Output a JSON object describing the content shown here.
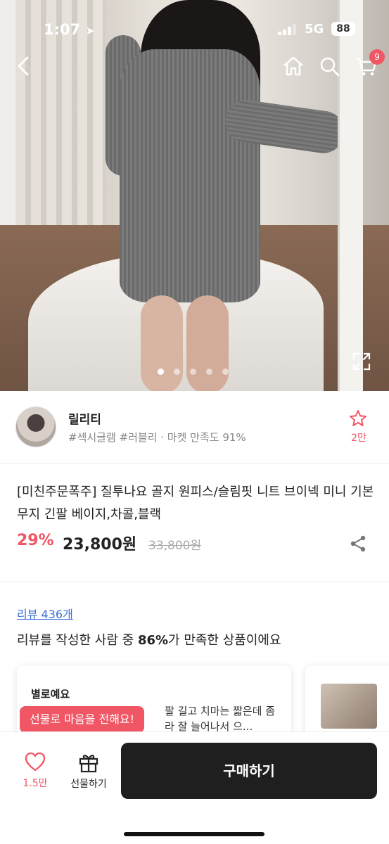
{
  "status_bar": {
    "time": "1:07",
    "network": "5G",
    "battery": "88"
  },
  "header": {
    "cart_count": "9"
  },
  "gallery": {
    "total_images": 5,
    "active_index": 0
  },
  "shop": {
    "name": "릴리티",
    "tags": "#섹시글램 #러블리 · 마켓 만족도 91%",
    "follow_count": "2만"
  },
  "product": {
    "title": "[미친주문폭주] 질투나요 골지 원피스/슬림핏 니트 브이넥 미니 기본 무지 긴팔 베이지,차콜,블랙",
    "discount": "29%",
    "price": "23,800원",
    "original_price": "33,800원"
  },
  "reviews": {
    "link": "리뷰 436개",
    "summary_prefix": "리뷰를 작성한 사람 중 ",
    "summary_percent": "86%",
    "summary_suffix": "가 만족한 상품이에요",
    "card": {
      "title": "별로예요",
      "text": "팔 길고 치마는 짧은데 좀라 잘 늘어나서 으..."
    }
  },
  "gift_tooltip": "선물로 마음을 전해요!",
  "bottom_bar": {
    "like_count": "1.5만",
    "gift_label": "선물하기",
    "buy_label": "구매하기"
  },
  "colors": {
    "accent": "#f15664",
    "buy_button": "#1f1f1f",
    "link": "#3a6fd8"
  }
}
